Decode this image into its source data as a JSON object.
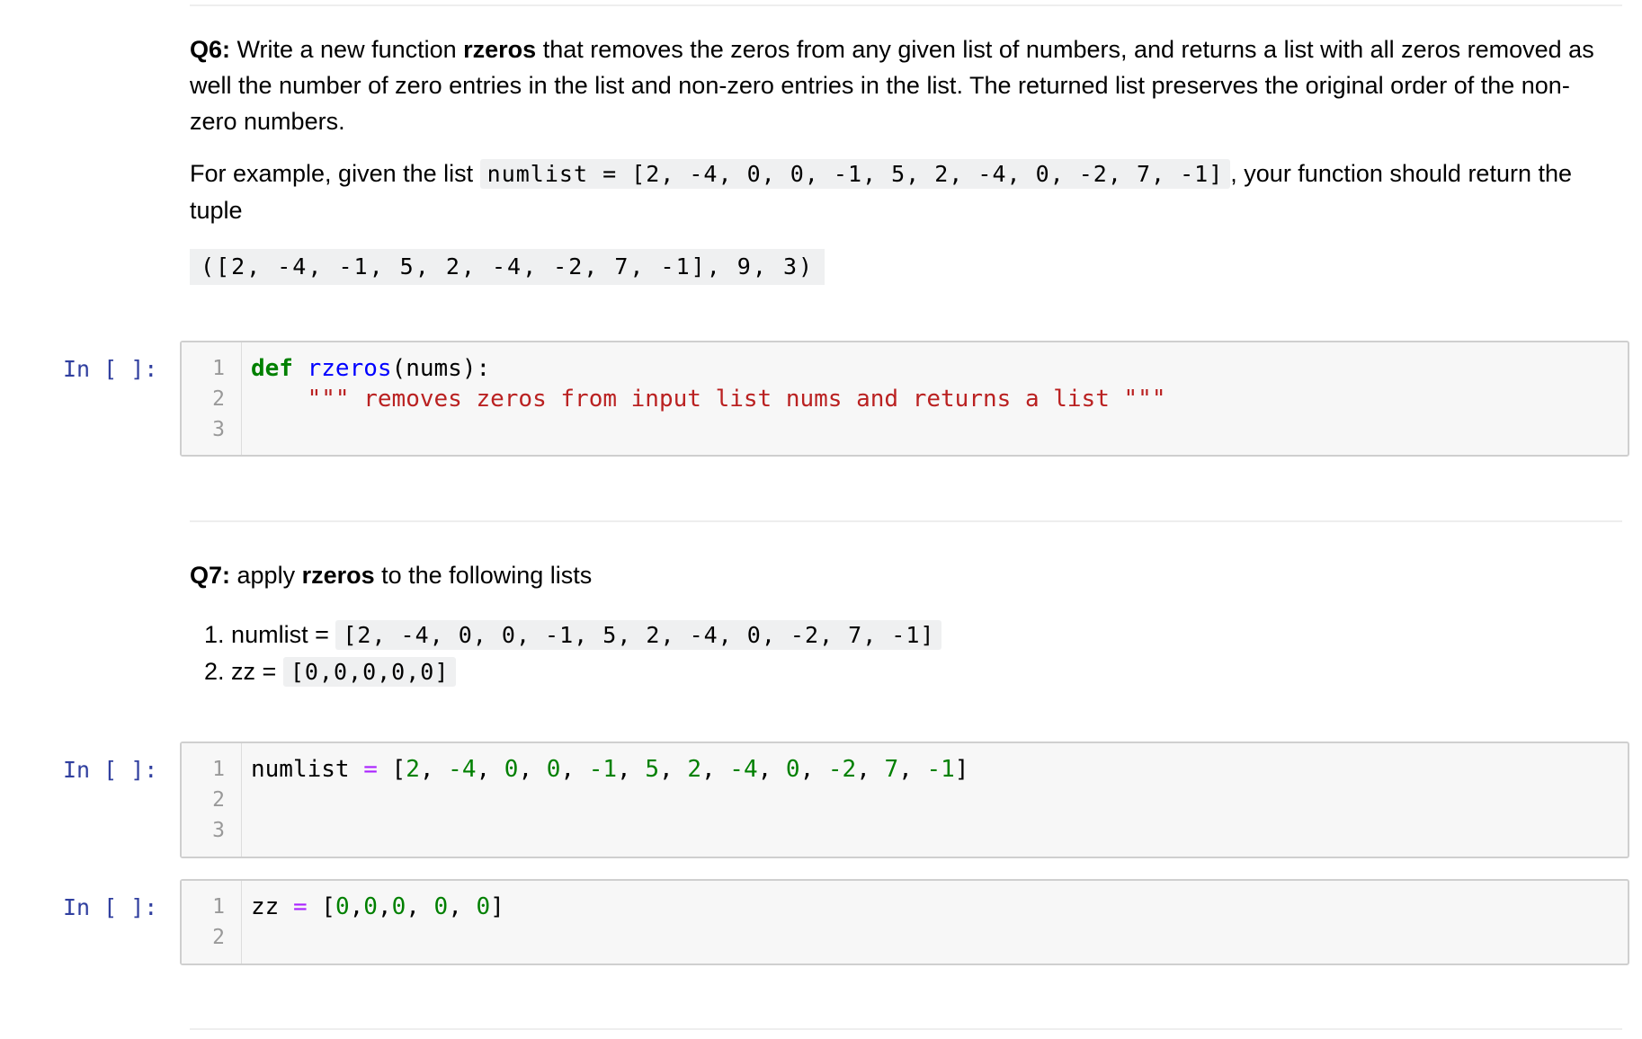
{
  "q6": {
    "label": "Q6:",
    "text1": " Write a new function ",
    "fn_name": "rzeros",
    "text2": " that removes the zeros from any given list of numbers, and returns a list with all zeros removed as well the number of zero entries in the list and non-zero entries in the list. The returned list preserves the original order of the non-zero numbers.",
    "example_prefix": "For example, given the list ",
    "example_code": "numlist = [2, -4, 0, 0, -1, 5, 2, -4, 0, -2, 7, -1]",
    "example_suffix": ", your function should return the tuple",
    "tuple_code": "([2, -4, -1, 5, 2, -4, -2, 7, -1], 9, 3)"
  },
  "cell1": {
    "prompt": "In [ ]:",
    "line_numbers": [
      "1",
      "2",
      "3"
    ],
    "tokens": {
      "def": "def",
      "fname": "rzeros",
      "args": "(nums):",
      "indent": "    ",
      "docstring": "\"\"\" removes zeros from input list nums and returns a list \"\"\""
    }
  },
  "q7": {
    "label": "Q7:",
    "text1": " apply ",
    "fn_name": "rzeros",
    "text2": " to the following lists",
    "items": [
      {
        "num": "1.",
        "label": "numlist = ",
        "code": "[2, -4, 0, 0, -1, 5, 2, -4, 0, -2, 7, -1]"
      },
      {
        "num": "2.",
        "label": "zz = ",
        "code": "[0,0,0,0,0]"
      }
    ]
  },
  "cell2": {
    "prompt": "In [ ]:",
    "line_numbers": [
      "1",
      "2",
      "3"
    ],
    "tokens": {
      "var": "numlist",
      "eq": "=",
      "open": "[",
      "n1": "2",
      "n2": "-4",
      "n3": "0",
      "n4": "0",
      "n5": "-1",
      "n6": "5",
      "n7": "2",
      "n8": "-4",
      "n9": "0",
      "n10": "-2",
      "n11": "7",
      "n12": "-1",
      "close": "]"
    }
  },
  "cell3": {
    "prompt": "In [ ]:",
    "line_numbers": [
      "1",
      "2"
    ],
    "tokens": {
      "var": "zz",
      "eq": "=",
      "open": "[",
      "n1": "0",
      "n2": "0",
      "n3": "0",
      "n4": "0",
      "n5": "0",
      "close": "]"
    }
  }
}
